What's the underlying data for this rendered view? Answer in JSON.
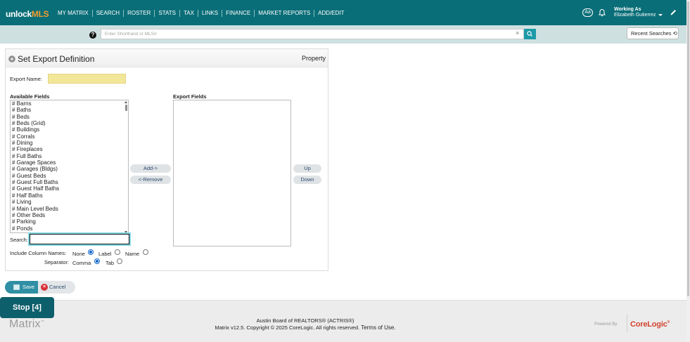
{
  "header": {
    "logo_main": "unlock",
    "logo_accent": "MLS",
    "nav": [
      "MY MATRIX",
      "SEARCH",
      "ROSTER",
      "STATS",
      "TAX",
      "LINKS",
      "FINANCE",
      "MARKET REPORTS",
      "ADD/EDIT"
    ],
    "font_size_button": "Aa",
    "working_as_label": "Working As",
    "user_name": "Elizabeth Gutierrez",
    "colors": {
      "bar": "#0a6e78",
      "accent": "#f39c2d"
    }
  },
  "search": {
    "placeholder": "Enter Shorthand or MLS#",
    "help_symbol": "?",
    "clear_symbol": "×",
    "recent_searches_label": "Recent Searches",
    "recent_icon": "⟲"
  },
  "panel": {
    "title": "Set Export Definition",
    "property_class": "Property",
    "export_name_label": "Export Name:",
    "export_name_value": "",
    "available_fields_label": "Available Fields",
    "export_fields_label": "Export Fields",
    "available_fields": [
      "# Barns",
      "# Baths",
      "# Beds",
      "# Beds (Grid)",
      "# Buildings",
      "# Corrals",
      "# Dining",
      "# Fireplaces",
      "# Full Baths",
      "# Garage Spaces",
      "# Garages (Bldgs)",
      "# Guest Beds",
      "# Guest Full Baths",
      "# Guest Half Baths",
      "# Half Baths",
      "# Living",
      "# Main Level Beds",
      "# Other Beds",
      "# Parking",
      "# Ponds"
    ],
    "export_fields": [],
    "add_button": "Add->",
    "remove_button": "<-Remove",
    "up_button": "Up",
    "down_button": "Down",
    "search_label": "Search:",
    "search_value": "",
    "include_column_names_label": "Include Column Names:",
    "column_name_options": [
      {
        "label": "None",
        "selected": true
      },
      {
        "label": "Label",
        "selected": false
      },
      {
        "label": "Name",
        "selected": false
      }
    ],
    "separator_label": "Separator:",
    "separator_options": [
      {
        "label": "Comma",
        "selected": true
      },
      {
        "label": "Tab",
        "selected": false
      }
    ]
  },
  "actions": {
    "save_label": "Save",
    "cancel_label": "Cancel",
    "cancel_symbol": "×",
    "stop_label": "Stop [4]"
  },
  "footer": {
    "matrix_logo": "Matrix",
    "matrix_tm": "™",
    "org": "Austin Board of REALTORS® (ACTRIS®)",
    "copyright": "Matrix v12.5. Copyright © 2025 CoreLogic. All rights reserved.",
    "terms": "Terms of Use.",
    "powered_by": "Powered By",
    "corelogic": "CoreLogic",
    "corelogic_tm": "®"
  }
}
